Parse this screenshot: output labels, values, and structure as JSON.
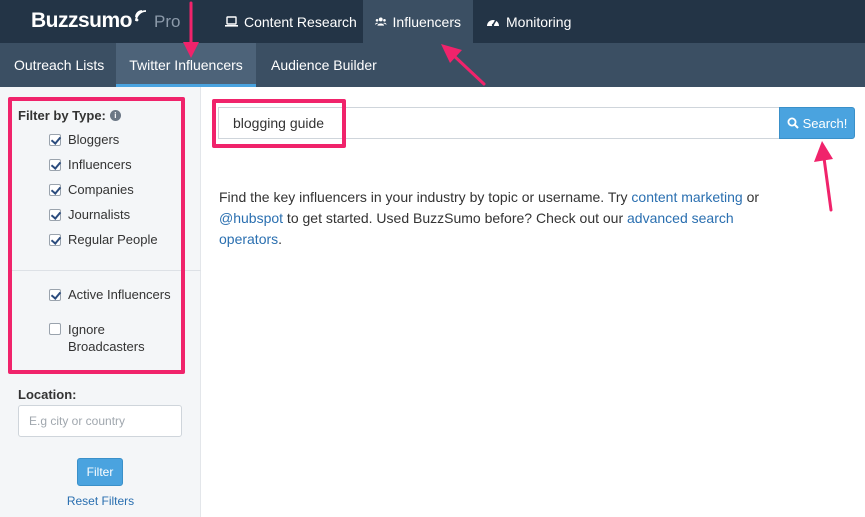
{
  "app": {
    "logo": "Buzzsumo",
    "logo_suffix": "Pro"
  },
  "nav": {
    "items": [
      {
        "label": "Content Research",
        "icon": "laptop-icon"
      },
      {
        "label": "Influencers",
        "icon": "users-icon"
      },
      {
        "label": "Monitoring",
        "icon": "dashboard-icon"
      }
    ],
    "active": "Influencers"
  },
  "subnav": {
    "items": [
      {
        "label": "Outreach Lists"
      },
      {
        "label": "Twitter Influencers"
      },
      {
        "label": "Audience Builder"
      }
    ],
    "active": "Twitter Influencers"
  },
  "sidebar": {
    "filter_title": "Filter by Type:",
    "types": [
      {
        "label": "Bloggers",
        "checked": true
      },
      {
        "label": "Influencers",
        "checked": true
      },
      {
        "label": "Companies",
        "checked": true
      },
      {
        "label": "Journalists",
        "checked": true
      },
      {
        "label": "Regular People",
        "checked": true
      }
    ],
    "options": [
      {
        "label": "Active Influencers",
        "checked": true
      },
      {
        "label": "Ignore Broadcasters",
        "checked": false
      }
    ],
    "location_label": "Location:",
    "location_placeholder": "E.g city or country",
    "filter_button": "Filter",
    "reset_link": "Reset Filters"
  },
  "search": {
    "value": "blogging guide",
    "button": "Search!"
  },
  "intro": {
    "text1": "Find the key influencers in your industry by topic or username. Try ",
    "link1": "content marketing",
    "text2": " or ",
    "link2": "@hubspot",
    "text3": " to get started. Used BuzzSumo before? Check out our ",
    "link3": "advanced search operators",
    "text4": "."
  },
  "colors": {
    "topbar": "#233446",
    "subbar": "#3b4f63",
    "accent": "#4aa3df",
    "highlight": "#f0236b",
    "link": "#2a6fb0"
  }
}
